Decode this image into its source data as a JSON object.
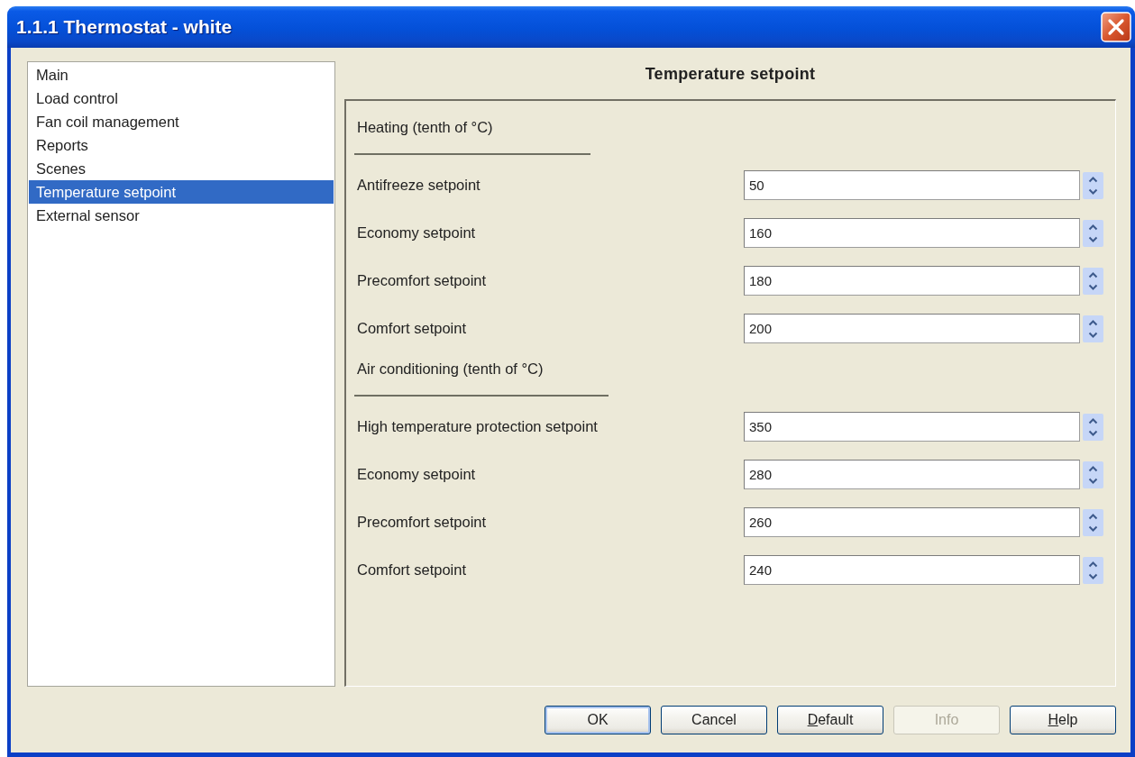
{
  "window": {
    "title": "1.1.1 Thermostat - white"
  },
  "sidebar": {
    "items": [
      {
        "label": "Main",
        "selected": false
      },
      {
        "label": "Load control",
        "selected": false
      },
      {
        "label": "Fan coil management",
        "selected": false
      },
      {
        "label": "Reports",
        "selected": false
      },
      {
        "label": "Scenes",
        "selected": false
      },
      {
        "label": "Temperature setpoint",
        "selected": true
      },
      {
        "label": "External sensor",
        "selected": false
      }
    ]
  },
  "panel": {
    "title": "Temperature setpoint",
    "groups": [
      {
        "title": "Heating (tenth of °C)",
        "fields": [
          {
            "label": "Antifreeze setpoint",
            "value": "50"
          },
          {
            "label": "Economy setpoint",
            "value": "160"
          },
          {
            "label": "Precomfort setpoint",
            "value": "180"
          },
          {
            "label": "Comfort setpoint",
            "value": "200"
          }
        ]
      },
      {
        "title": "Air conditioning (tenth of °C)",
        "fields": [
          {
            "label": "High temperature protection setpoint",
            "value": "350"
          },
          {
            "label": "Economy setpoint",
            "value": "280"
          },
          {
            "label": "Precomfort setpoint",
            "value": "260"
          },
          {
            "label": "Comfort setpoint",
            "value": "240"
          }
        ]
      }
    ]
  },
  "buttons": [
    {
      "label": "OK",
      "default": true,
      "disabled": false,
      "mnemonic_underlined": false
    },
    {
      "label": "Cancel",
      "default": false,
      "disabled": false,
      "mnemonic_underlined": false
    },
    {
      "label": "Default",
      "default": false,
      "disabled": false,
      "mnemonic_underlined": true
    },
    {
      "label": "Info",
      "default": false,
      "disabled": true,
      "mnemonic_underlined": false
    },
    {
      "label": "Help",
      "default": false,
      "disabled": false,
      "mnemonic_underlined": true
    }
  ]
}
